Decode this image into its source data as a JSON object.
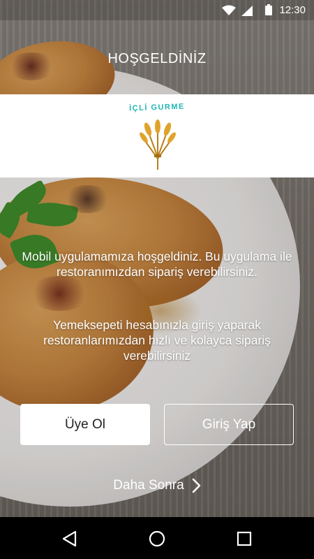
{
  "status_bar": {
    "time": "12:30",
    "icons": [
      "wifi-icon",
      "signal-icon",
      "battery-icon"
    ]
  },
  "welcome": {
    "title": "HOŞGELDİNİZ"
  },
  "logo": {
    "brand_text": "İÇLİ GURME",
    "icon": "wheat-icon",
    "color": "#21b5b5"
  },
  "messages": {
    "intro": "Mobil uygulamamıza hoşgeldiniz. Bu uygulama ile restoranımızdan sipariş verebilirsiniz.",
    "yemeksepeti": "Yemeksepeti hesabınızla giriş yaparak restoranlarımızdan hızlı ve kolayca sipariş verebilirsiniz"
  },
  "actions": {
    "signup_label": "Üye Ol",
    "login_label": "Giriş Yap",
    "later_label": "Daha Sonra",
    "later_icon": "chevron-right-icon"
  },
  "nav_bar": {
    "buttons": [
      "back-icon",
      "home-icon",
      "recent-apps-icon"
    ]
  }
}
